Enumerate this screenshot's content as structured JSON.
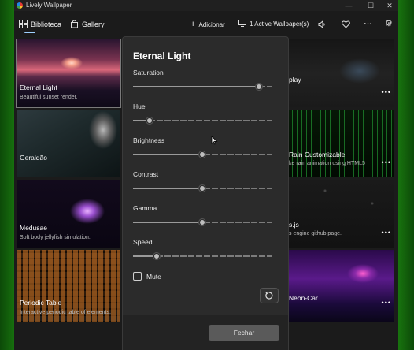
{
  "window": {
    "title": "Lively Wallpaper",
    "controls": [
      "—",
      "☐",
      "✕"
    ]
  },
  "nav": {
    "library_label": "Biblioteca",
    "gallery_label": "Gallery",
    "add_label": "Adicionar",
    "active_label": "1 Active Wallpaper(s)"
  },
  "cards": [
    {
      "title": "Eternal Light",
      "desc": "Beautiful sunset render.",
      "selected": true
    },
    {
      "title": "Geraldão",
      "desc": ""
    },
    {
      "title": "Medusae",
      "desc": "Soft body jellyfish simulation."
    },
    {
      "title": "Periodic Table",
      "desc": "Interactive periodic table of elements."
    },
    {
      "title": "play",
      "desc": ""
    },
    {
      "title": "Rain Customizable",
      "desc": "ke rain animation using HTML5"
    },
    {
      "title": "s.js",
      "desc": "s engine github page."
    },
    {
      "title": "Neon-Car",
      "desc": ""
    }
  ],
  "modal": {
    "title": "Eternal Light",
    "sliders": [
      {
        "label": "Saturation",
        "value": 0.91
      },
      {
        "label": "Hue",
        "value": 0.12
      },
      {
        "label": "Brightness",
        "value": 0.5
      },
      {
        "label": "Contrast",
        "value": 0.5
      },
      {
        "label": "Gamma",
        "value": 0.5
      },
      {
        "label": "Speed",
        "value": 0.17
      }
    ],
    "mute_label": "Mute",
    "mute_checked": false,
    "close_label": "Fechar"
  },
  "colors": {
    "accent": "#9ed0ff",
    "modal_bg": "#2b2b2b",
    "app_bg": "#1b1b1b"
  }
}
